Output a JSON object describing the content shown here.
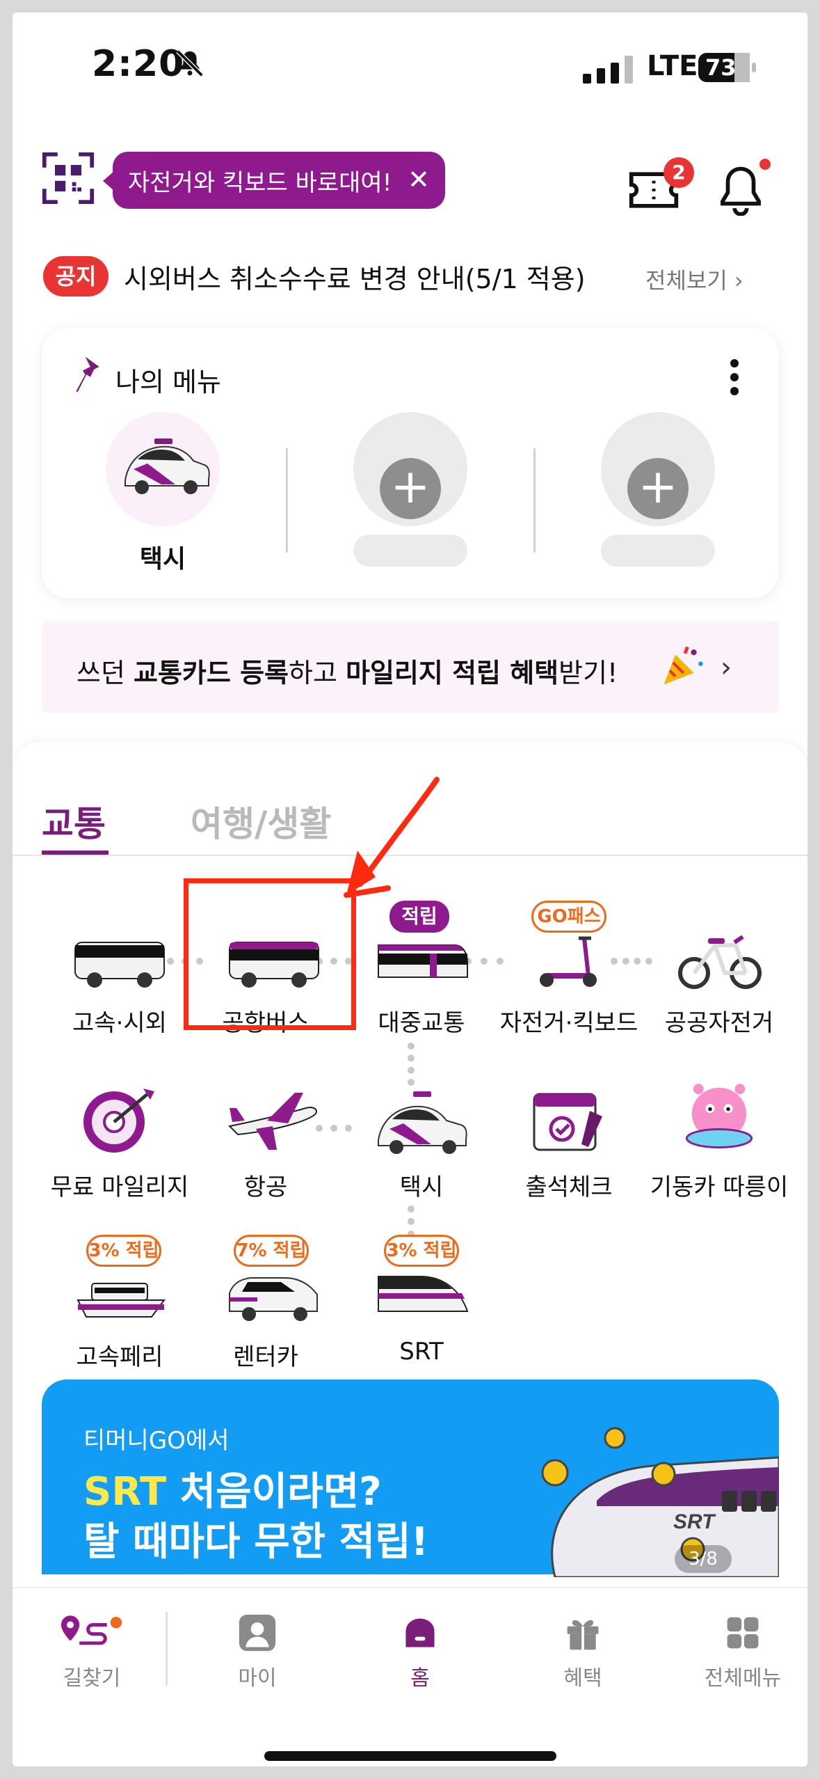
{
  "status_bar": {
    "time": "2:20",
    "network": "LTE",
    "battery": "73"
  },
  "header": {
    "promo_text": "자전거와 킥보드 바로대여!",
    "promo_close": "✕",
    "ticket_badge": "2"
  },
  "notice": {
    "tag": "공지",
    "text": "시외버스 취소수수료 변경 안내(5/1 적용)",
    "view_all": "전체보기 ›"
  },
  "my_menu": {
    "title": "나의 메뉴",
    "slots": [
      {
        "label": "택시"
      },
      {
        "label": ""
      },
      {
        "label": ""
      }
    ],
    "plus": "+"
  },
  "card_banner": {
    "part1": "쓰던 ",
    "part2": "교통카드 등록",
    "part3": "하고 ",
    "part4": "마일리지 적립 혜택",
    "part5": "받기!",
    "chevron": "›"
  },
  "tabs": {
    "transport": "교통",
    "travel": "여행/생활"
  },
  "services": {
    "row1": [
      {
        "label": "고속·시외"
      },
      {
        "label": "공항버스"
      },
      {
        "label": "대중교통",
        "tag": "적립"
      },
      {
        "label": "자전거·킥보드",
        "tag": "GO패스"
      },
      {
        "label": "공공자전거"
      }
    ],
    "row2": [
      {
        "label": "무료 마일리지"
      },
      {
        "label": "항공"
      },
      {
        "label": "택시"
      },
      {
        "label": "출석체크"
      },
      {
        "label": "기동카 따릉이"
      }
    ],
    "row3": [
      {
        "label": "고속페리",
        "tag": "3% 적립"
      },
      {
        "label": "렌터카",
        "tag": "7% 적립"
      },
      {
        "label": "SRT",
        "tag": "3% 적립"
      }
    ]
  },
  "srt_banner": {
    "sub": "티머니GO에서",
    "title_hl": "SRT",
    "title_rest": " 처음이라면?",
    "title2": "탈 때마다 무한 적립!",
    "page": "3/8",
    "train_logo": "SRT"
  },
  "bottom_nav": {
    "items": [
      {
        "label": "길찾기"
      },
      {
        "label": "마이"
      },
      {
        "label": "홈"
      },
      {
        "label": "혜택"
      },
      {
        "label": "전체메뉴"
      }
    ]
  },
  "colors": {
    "brand": "#7b1e7b",
    "promo": "#8e1a8e",
    "alert": "#e93434",
    "orange": "#ee6a1a",
    "banner_blue": "#129cf3",
    "annotation_red": "#ff2a10"
  }
}
